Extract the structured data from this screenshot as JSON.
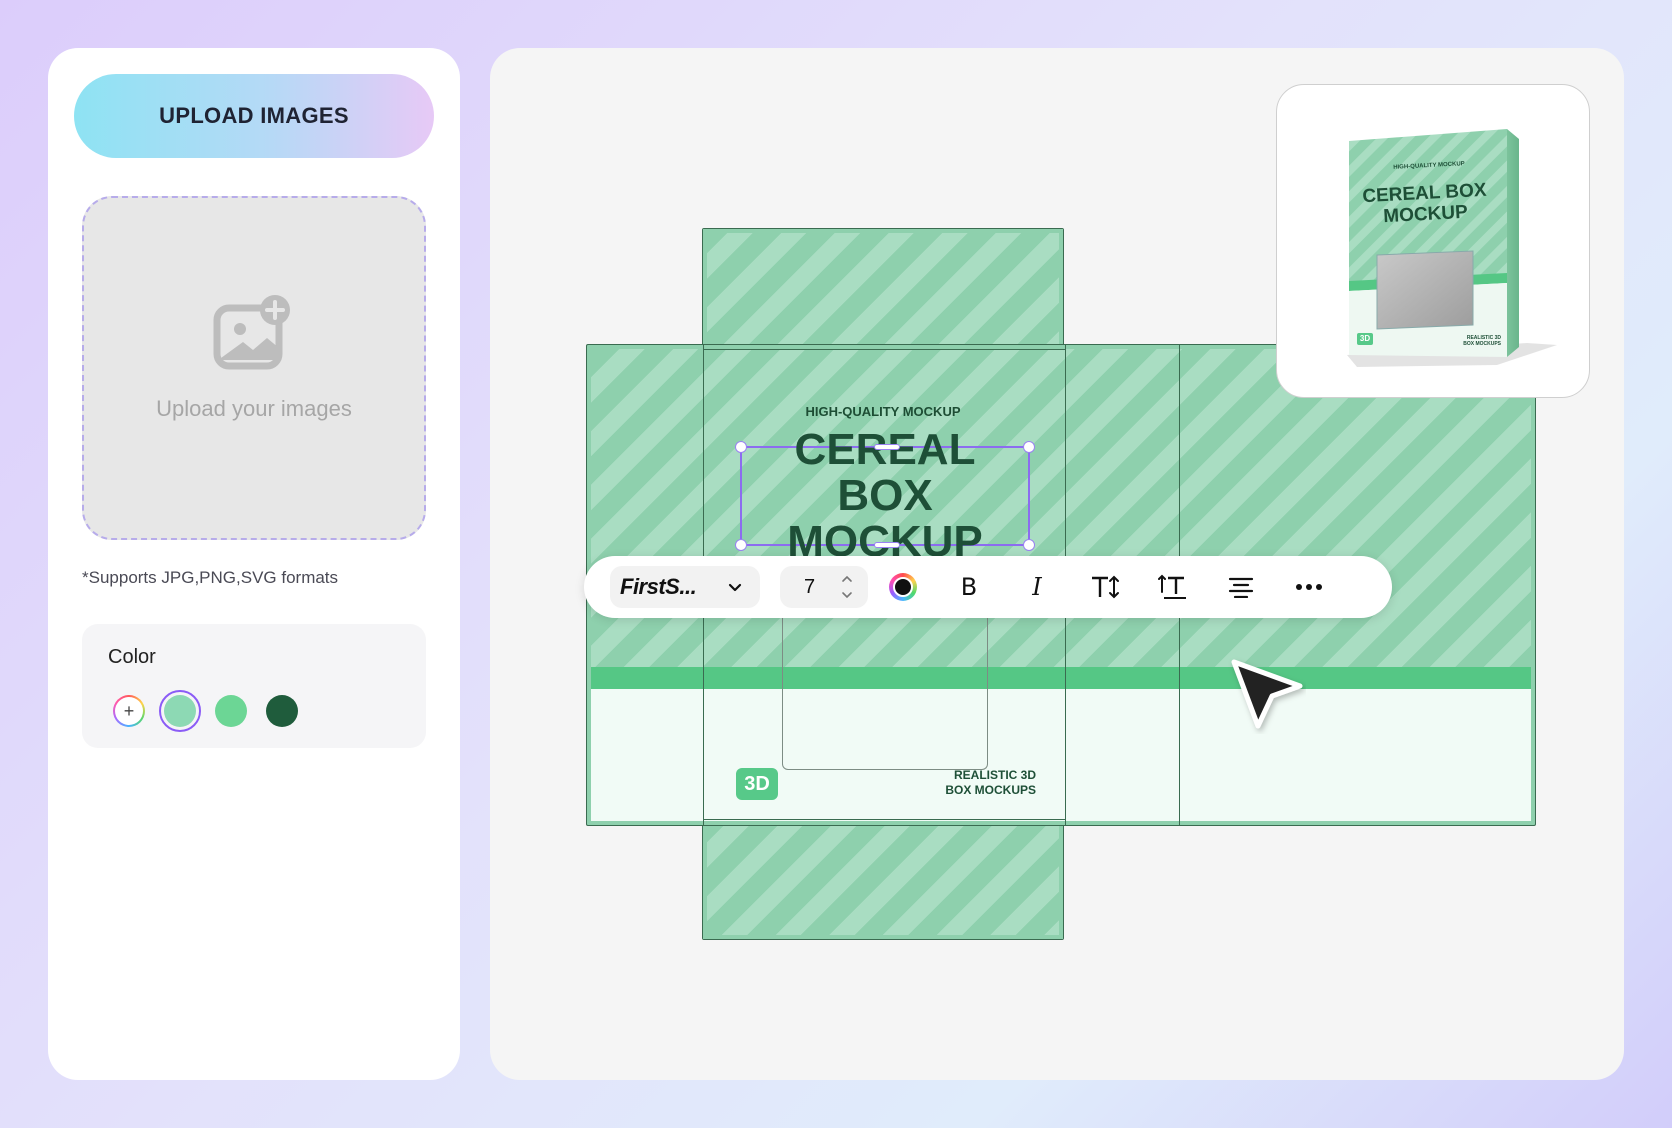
{
  "sidebar": {
    "upload_button": "UPLOAD IMAGES",
    "dropzone_text": "Upload your images",
    "formats_note": "*Supports JPG,PNG,SVG formats",
    "color": {
      "title": "Color",
      "swatches": [
        "#8dd9b4",
        "#6cd695",
        "#1f5c3c"
      ],
      "selected_index": 0
    }
  },
  "canvas": {
    "box": {
      "top_label": "HIGH-QUALITY MOCKUP",
      "title_line1": "CEREAL BOX",
      "title_line2": "MOCKUP",
      "badge": "3D",
      "tagline_line1": "REALISTIC 3D",
      "tagline_line2": "BOX MOCKUPS",
      "colors": {
        "pattern": "#8ed0ad",
        "stripe": "#a9ddc2",
        "band": "#55c785",
        "text": "#1e4f37"
      }
    },
    "toolbar": {
      "font_name": "FirstS...",
      "font_size": "7",
      "bold_label": "B",
      "italic_label": "I"
    },
    "preview": {
      "top_label": "HIGH-QUALITY MOCKUP",
      "title_line1": "CEREAL BOX",
      "title_line2": "MOCKUP",
      "badge": "3D",
      "tagline_line1": "REALISTIC 3D",
      "tagline_line2": "BOX MOCKUPS"
    }
  }
}
